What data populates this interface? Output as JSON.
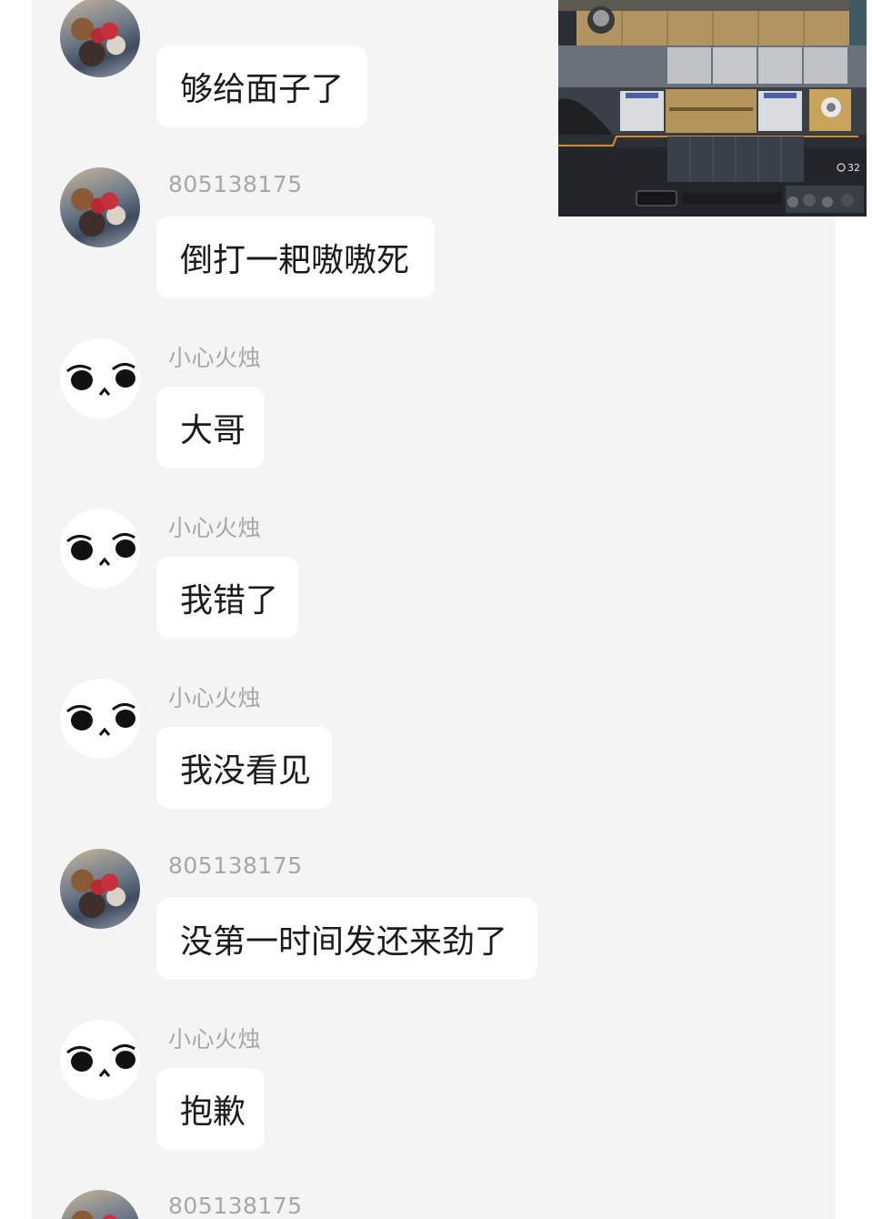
{
  "messages": [
    {
      "sender": "",
      "avatar": "photo",
      "text": "够给面子了"
    },
    {
      "sender": "805138175",
      "avatar": "photo",
      "text": "倒打一耙嗷嗷死"
    },
    {
      "sender": "小心火烛",
      "avatar": "face",
      "text": "大哥"
    },
    {
      "sender": "小心火烛",
      "avatar": "face",
      "text": "我错了"
    },
    {
      "sender": "小心火烛",
      "avatar": "face",
      "text": "我没看见"
    },
    {
      "sender": "805138175",
      "avatar": "photo",
      "text": "没第一时间发还来劲了"
    },
    {
      "sender": "小心火烛",
      "avatar": "face",
      "text": "抱歉"
    },
    {
      "sender": "805138175",
      "avatar": "photo",
      "text": ""
    }
  ],
  "game_screenshot": {
    "counter": "32"
  }
}
